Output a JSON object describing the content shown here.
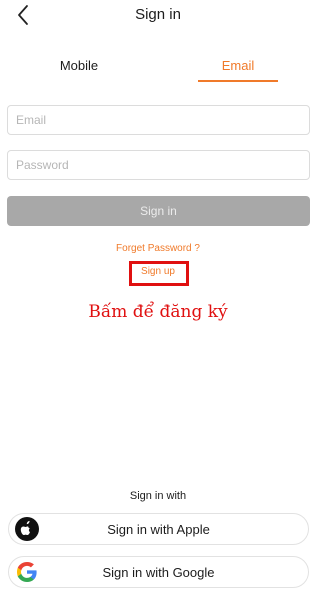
{
  "header": {
    "title": "Sign in",
    "back_icon": "chevron-left-icon"
  },
  "tabs": [
    {
      "label": "Mobile",
      "active": false
    },
    {
      "label": "Email",
      "active": true
    }
  ],
  "form": {
    "email_placeholder": "Email",
    "email_value": "",
    "password_placeholder": "Password",
    "password_value": "",
    "signin_label": "Sign in"
  },
  "links": {
    "forget_password": "Forget Password ?",
    "sign_up": "Sign up"
  },
  "annotation": {
    "text": "Bấm để đăng ký"
  },
  "social": {
    "heading": "Sign in with",
    "apple_label": "Sign in with Apple",
    "apple_icon": "apple-logo-icon",
    "google_label": "Sign in with Google",
    "google_icon": "google-logo-icon"
  },
  "colors": {
    "accent": "#f07a2a",
    "highlight_red": "#e01010",
    "disabled_button": "#a8a8a8"
  }
}
